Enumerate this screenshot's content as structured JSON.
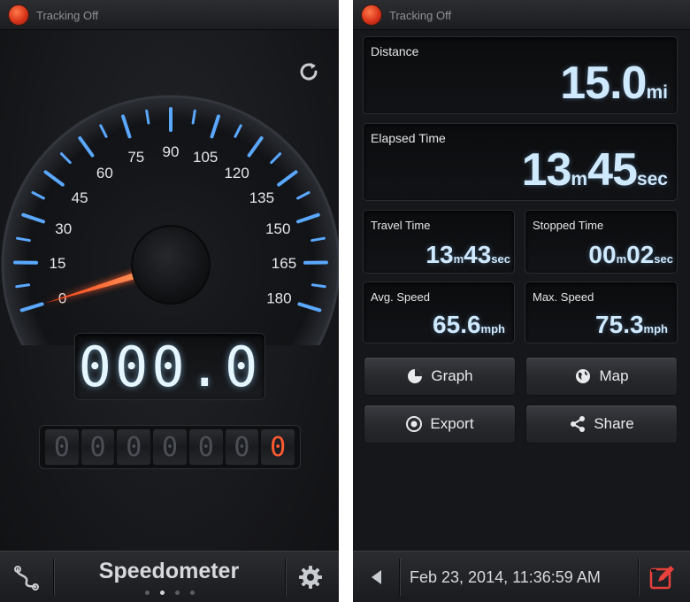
{
  "left": {
    "status": "Tracking Off",
    "gauge_labels": [
      "0",
      "15",
      "30",
      "45",
      "60",
      "75",
      "90",
      "105",
      "120",
      "135",
      "150",
      "165",
      "180"
    ],
    "speed_value": 0,
    "digital_speed": "000.0",
    "odometer": [
      "0",
      "0",
      "0",
      "0",
      "0",
      "0",
      "0"
    ],
    "title": "Speedometer",
    "page_dots": 4,
    "active_dot": 1,
    "icons": {
      "refresh": "refresh-icon",
      "route": "route-icon",
      "settings": "gear-icon"
    },
    "accent_colors": {
      "ticks": "#5aa8ff",
      "needle": "#ff5a2a",
      "lcd": "#e6f6ff"
    }
  },
  "right": {
    "status": "Tracking Off",
    "distance": {
      "label": "Distance",
      "value": "15.0",
      "unit": "mi"
    },
    "elapsed": {
      "label": "Elapsed Time",
      "min": "13",
      "min_unit": "m",
      "sec": "45",
      "sec_unit": "sec"
    },
    "travel": {
      "label": "Travel Time",
      "min": "13",
      "min_unit": "m",
      "sec": "43",
      "sec_unit": "sec"
    },
    "stopped": {
      "label": "Stopped Time",
      "min": "00",
      "min_unit": "m",
      "sec": "02",
      "sec_unit": "sec"
    },
    "avg": {
      "label": "Avg. Speed",
      "value": "65.6",
      "unit": "mph"
    },
    "max": {
      "label": "Max. Speed",
      "value": "75.3",
      "unit": "mph"
    },
    "buttons": {
      "graph": "Graph",
      "map": "Map",
      "export": "Export",
      "share": "Share"
    },
    "date": "Feb 23, 2014, 11:36:59 AM",
    "icons": {
      "graph": "pie-chart-icon",
      "map": "globe-icon",
      "export": "export-icon",
      "share": "share-icon",
      "back": "back-arrow-icon",
      "edit": "edit-icon"
    },
    "accent_colors": {
      "value": "#cfe9ff",
      "edit": "#e8403a"
    }
  }
}
